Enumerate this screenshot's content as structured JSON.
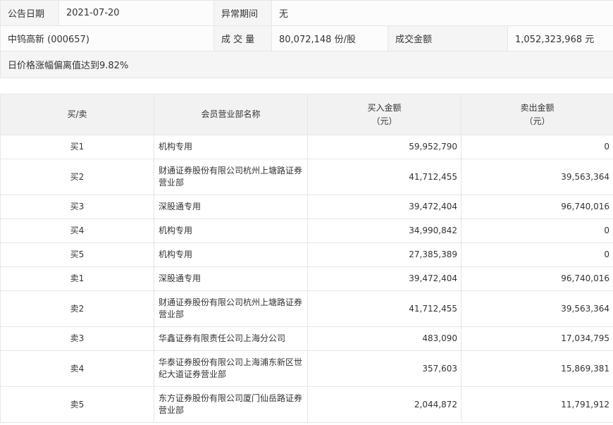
{
  "summary": {
    "date_label": "公告日期",
    "date_value": "2021-07-20",
    "period_label": "异常期间",
    "period_value": "无",
    "stock": "中钨高新 (000657)",
    "volume_label": "成 交 量",
    "volume_value": "80,072,148 份/股",
    "amount_label": "成交金额",
    "amount_value": "1,052,323,968 元",
    "reason": "日价格涨幅偏离值达到9.82%"
  },
  "table": {
    "headers": {
      "direction": "买/卖",
      "branch": "会员营业部名称",
      "buy_line1": "买入金额",
      "buy_line2": "（元）",
      "sell_line1": "卖出金额",
      "sell_line2": "（元）"
    },
    "rows": [
      {
        "dir": "买1",
        "name": "机构专用",
        "buy": "59,952,790",
        "sell": "0"
      },
      {
        "dir": "买2",
        "name": "财通证券股份有限公司杭州上塘路证券营业部",
        "buy": "41,712,455",
        "sell": "39,563,364"
      },
      {
        "dir": "买3",
        "name": "深股通专用",
        "buy": "39,472,404",
        "sell": "96,740,016"
      },
      {
        "dir": "买4",
        "name": "机构专用",
        "buy": "34,990,842",
        "sell": "0"
      },
      {
        "dir": "买5",
        "name": "机构专用",
        "buy": "27,385,389",
        "sell": "0"
      },
      {
        "dir": "卖1",
        "name": "深股通专用",
        "buy": "39,472,404",
        "sell": "96,740,016"
      },
      {
        "dir": "卖2",
        "name": "财通证券股份有限公司杭州上塘路证券营业部",
        "buy": "41,712,455",
        "sell": "39,563,364"
      },
      {
        "dir": "卖3",
        "name": "华鑫证券有限责任公司上海分公司",
        "buy": "483,090",
        "sell": "17,034,795"
      },
      {
        "dir": "卖4",
        "name": "华泰证券股份有限公司上海浦东新区世纪大道证券营业部",
        "buy": "357,603",
        "sell": "15,869,381"
      },
      {
        "dir": "卖5",
        "name": "东方证券股份有限公司厦门仙岳路证券营业部",
        "buy": "2,044,872",
        "sell": "11,791,912"
      }
    ]
  }
}
